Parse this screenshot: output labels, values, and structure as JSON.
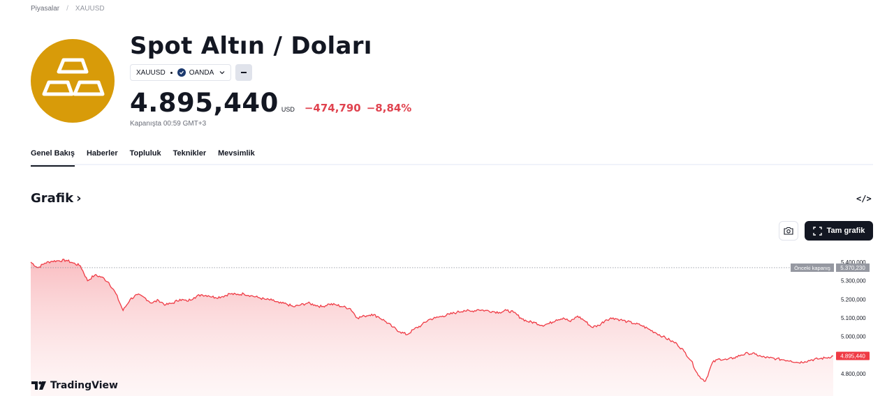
{
  "breadcrumb": {
    "items": [
      "Piyasalar",
      "XAUUSD"
    ]
  },
  "header": {
    "title": "Spot Altın / Doları",
    "symbol": "XAUUSD",
    "exchange": "OANDA",
    "price": "4.895,440",
    "currency": "USD",
    "change": "−474,790",
    "change_percent": "−8,84%",
    "close_note": "Kapanışta 00:59 GMT+3"
  },
  "tabs": [
    {
      "label": "Genel Bakış",
      "active": true
    },
    {
      "label": "Haberler"
    },
    {
      "label": "Topluluk"
    },
    {
      "label": "Teknikler"
    },
    {
      "label": "Mevsimlik"
    }
  ],
  "section": {
    "title": "Grafik",
    "chevron": "›",
    "embed_icon": "</>"
  },
  "toolbar": {
    "camera_icon": "camera-icon",
    "full_chart_label": "Tam grafik"
  },
  "branding": {
    "label": "TradingView"
  },
  "colors": {
    "down": "#e0434f",
    "logo_bg": "#d89b09",
    "line": "#ef3b45"
  },
  "chart_data": {
    "type": "area",
    "y_ticks": [
      "5.400,000",
      "5.300,000",
      "5.200,000",
      "5.100,000",
      "5.000,000",
      "4.800,000"
    ],
    "y_tick_values": [
      5400000,
      5300000,
      5200000,
      5100000,
      5000000,
      4800000
    ],
    "ylim": [
      4700000,
      5450000
    ],
    "prev_close": {
      "label": "Önceki kapanış",
      "value": 5370230,
      "value_label": "5.370,230"
    },
    "last": {
      "value": 4895440,
      "value_label": "4.895,440"
    },
    "values": [
      5400000,
      5370000,
      5395000,
      5405000,
      5408000,
      5410000,
      5395000,
      5380000,
      5300000,
      5330000,
      5320000,
      5290000,
      5230000,
      5140000,
      5200000,
      5225000,
      5210000,
      5180000,
      5195000,
      5170000,
      5180000,
      5200000,
      5190000,
      5210000,
      5225000,
      5220000,
      5210000,
      5215000,
      5230000,
      5225000,
      5230000,
      5220000,
      5210000,
      5200000,
      5195000,
      5180000,
      5175000,
      5160000,
      5170000,
      5180000,
      5170000,
      5160000,
      5175000,
      5170000,
      5160000,
      5150000,
      5100000,
      5110000,
      5120000,
      5105000,
      5080000,
      5050000,
      5025000,
      5010000,
      5040000,
      5060000,
      5090000,
      5100000,
      5110000,
      5120000,
      5130000,
      5140000,
      5135000,
      5145000,
      5140000,
      5135000,
      5130000,
      5140000,
      5130000,
      5100000,
      5080000,
      5075000,
      5060000,
      5070000,
      5090000,
      5100000,
      5080000,
      5110000,
      5085000,
      5050000,
      5060000,
      5090000,
      5100000,
      5090000,
      5080000,
      5070000,
      5060000,
      5040000,
      5020000,
      5000000,
      4980000,
      4960000,
      4920000,
      4870000,
      4790000,
      4760000,
      4860000,
      4880000,
      4875000,
      4885000,
      4900000,
      4910000,
      4905000,
      4890000,
      4885000,
      4880000,
      4875000,
      4870000,
      4860000,
      4865000,
      4875000,
      4880000,
      4885000,
      4895440
    ]
  }
}
